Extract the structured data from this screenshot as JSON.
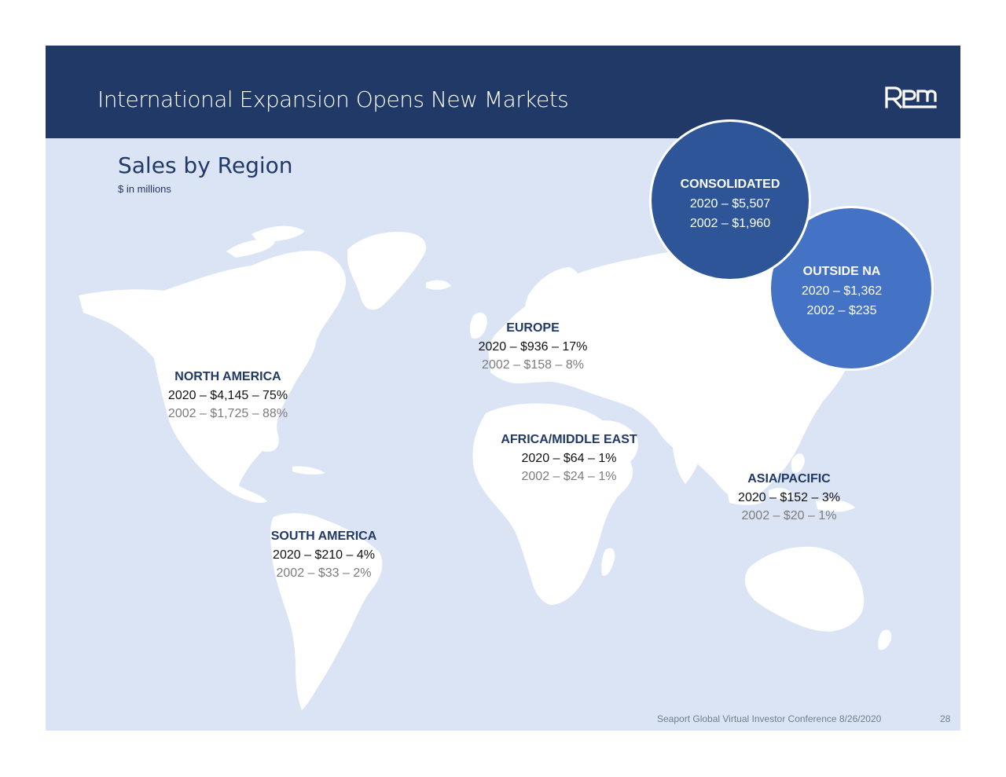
{
  "header": {
    "title": "International Expansion Opens New Markets",
    "logo_text": "RPM",
    "bg_color": "#213966"
  },
  "section": {
    "title": "Sales by Region",
    "units": "$ in millions"
  },
  "regions": {
    "north_america": {
      "name": "NORTH AMERICA",
      "line_2020": "2020 – $4,145 – 75%",
      "line_2002": "2002 – $1,725 – 88%"
    },
    "europe": {
      "name": "EUROPE",
      "line_2020": "2020 – $936 – 17%",
      "line_2002": "2002 – $158 –   8%"
    },
    "africa_middle_east": {
      "name": "AFRICA/MIDDLE EAST",
      "line_2020": "2020 – $64 – 1%",
      "line_2002": "2002 – $24 – 1%"
    },
    "asia_pacific": {
      "name": "ASIA/PACIFIC",
      "line_2020": "2020 – $152 – 3%",
      "line_2002": "2002 –   $20 – 1%"
    },
    "south_america": {
      "name": "SOUTH AMERICA",
      "line_2020": "2020 – $210 – 4%",
      "line_2002": "2002 –   $33 – 2%"
    }
  },
  "callouts": {
    "consolidated": {
      "name": "CONSOLIDATED",
      "line_2020": "2020 – $5,507",
      "line_2002": "2002 – $1,960",
      "color": "#2d5597"
    },
    "outside_na": {
      "name": "OUTSIDE NA",
      "line_2020": "2020 – $1,362",
      "line_2002": "2002 –    $235",
      "color": "#4472c4"
    }
  },
  "footer": {
    "text": "Seaport Global Virtual Investor Conference 8/26/2020",
    "page": "28"
  }
}
